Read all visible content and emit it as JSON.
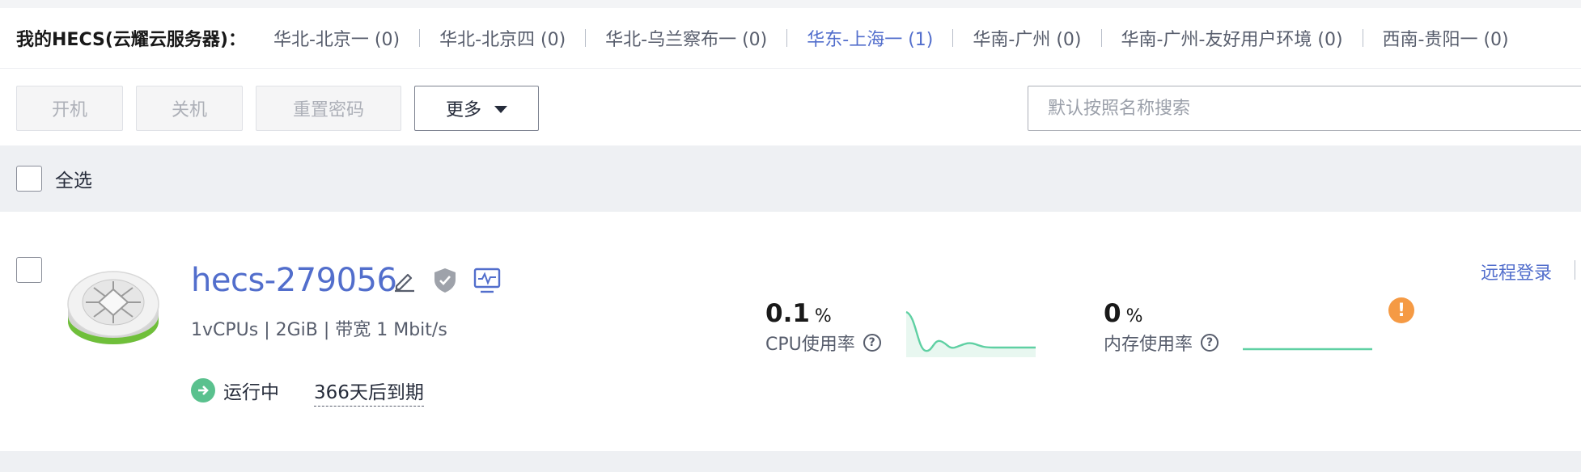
{
  "region_bar": {
    "title": "我的HECS(云耀云服务器)：",
    "regions": [
      {
        "label": "华北-北京一 (0)",
        "active": false
      },
      {
        "label": "华北-北京四 (0)",
        "active": false
      },
      {
        "label": "华北-乌兰察布一 (0)",
        "active": false
      },
      {
        "label": "华东-上海一 (1)",
        "active": true
      },
      {
        "label": "华南-广州 (0)",
        "active": false
      },
      {
        "label": "华南-广州-友好用户环境 (0)",
        "active": false
      },
      {
        "label": "西南-贵阳一 (0)",
        "active": false
      }
    ]
  },
  "toolbar": {
    "start_label": "开机",
    "stop_label": "关机",
    "reset_password_label": "重置密码",
    "more_label": "更多",
    "search_placeholder": "默认按照名称搜索"
  },
  "select_all": {
    "label": "全选"
  },
  "server": {
    "name": "hecs-279056",
    "specs": "1vCPUs | 2GiB | 带宽 1 Mbit/s",
    "status": "运行中",
    "expiry": "366天后到期",
    "cpu": {
      "value": "0.1",
      "unit": "%",
      "label": "CPU使用率"
    },
    "memory": {
      "value": "0",
      "unit": "%",
      "label": "内存使用率"
    },
    "remote_login": "远程登录",
    "colors": {
      "link": "#526ecc",
      "running": "#5ac18e",
      "warning": "#f59a44",
      "spark": "#5fd0a3"
    }
  }
}
